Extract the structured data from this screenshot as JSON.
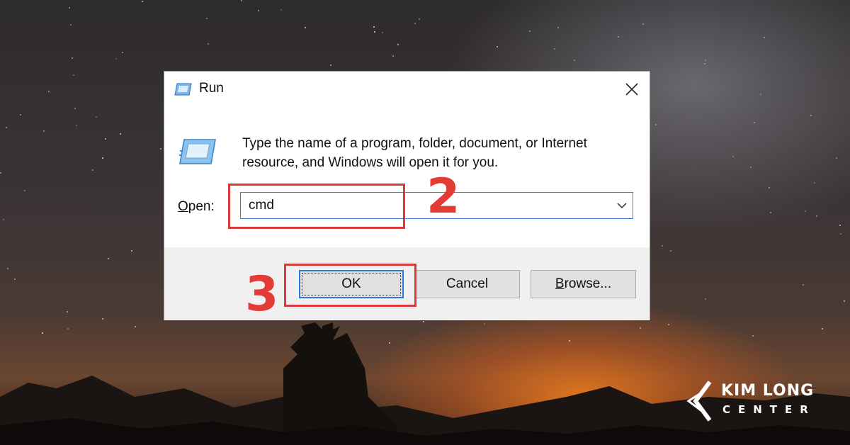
{
  "dialog": {
    "title": "Run",
    "description_line1": "Type the name of a program, folder, document, or Internet",
    "description_line2": "resource, and Windows will open it for you.",
    "open_label_underlined": "O",
    "open_label_rest": "pen:",
    "open_value": "cmd",
    "buttons": {
      "ok": "OK",
      "cancel": "Cancel",
      "browse_underlined": "B",
      "browse_rest": "rowse..."
    }
  },
  "annotations": {
    "step_input": "2",
    "step_ok": "3",
    "color": "#e33b35"
  },
  "logo": {
    "line1": "KIM LONG",
    "line2": "CENTER"
  },
  "icons": [
    "run-app-icon",
    "close-icon",
    "chevron-down-icon",
    "kimlong-logo-icon"
  ]
}
